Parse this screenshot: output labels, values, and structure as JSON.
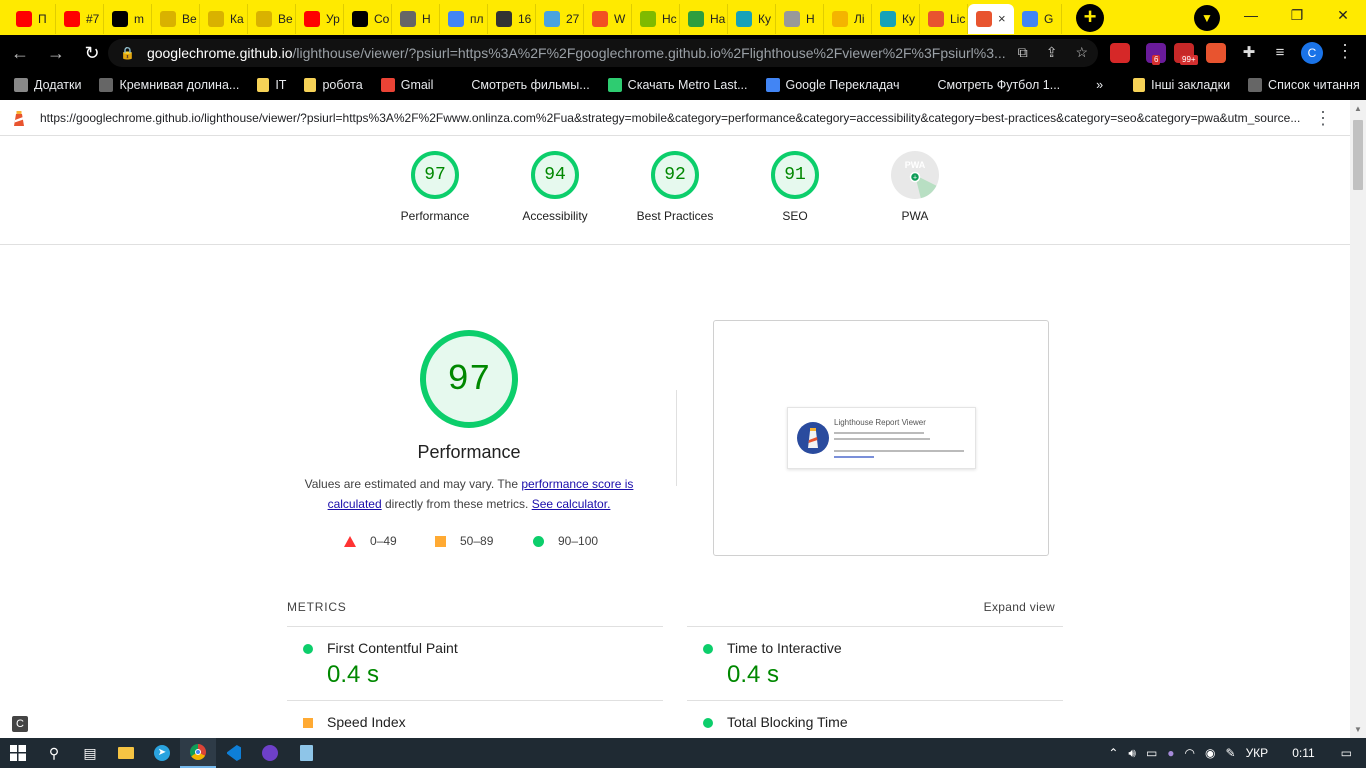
{
  "browser": {
    "tabs": [
      {
        "label": "П",
        "icon": "youtube-icon",
        "color": "#ff0000"
      },
      {
        "label": "#7",
        "icon": "youtube-icon",
        "color": "#ff0000"
      },
      {
        "label": "m",
        "icon": "github-icon",
        "color": "#000000"
      },
      {
        "label": "Ве",
        "icon": "wave-icon",
        "color": "#d9b200"
      },
      {
        "label": "Ка",
        "icon": "wave-icon",
        "color": "#d9b200"
      },
      {
        "label": "Ве",
        "icon": "wave-icon",
        "color": "#d9b200"
      },
      {
        "label": "Ур",
        "icon": "youtube-icon",
        "color": "#ff0000"
      },
      {
        "label": "Co",
        "icon": "z-icon",
        "color": "#000000"
      },
      {
        "label": "Н",
        "icon": "globe-icon",
        "color": "#666666"
      },
      {
        "label": "пл",
        "icon": "google-icon",
        "color": "#4285f4"
      },
      {
        "label": "16",
        "icon": "shield-icon",
        "color": "#333333"
      },
      {
        "label": "27",
        "icon": "cloud-icon",
        "color": "#4aa3df"
      },
      {
        "label": "W",
        "icon": "windows-icon",
        "color": "#f25022"
      },
      {
        "label": "Нс",
        "icon": "windows-icon",
        "color": "#7fba00"
      },
      {
        "label": "На",
        "icon": "leaf-icon",
        "color": "#2e9e3e"
      },
      {
        "label": "Ку",
        "icon": "on-icon",
        "color": "#17a2b8"
      },
      {
        "label": "Н",
        "icon": "gear-icon",
        "color": "#999999"
      },
      {
        "label": "Лі",
        "icon": "pie-icon",
        "color": "#f4b400"
      },
      {
        "label": "Ку",
        "icon": "on-icon",
        "color": "#17a2b8"
      },
      {
        "label": "Lic",
        "icon": "lighthouse-icon",
        "color": "#e8542f"
      },
      {
        "label": "G",
        "icon": "translate-icon",
        "color": "#4285f4"
      }
    ],
    "active_tab": {
      "label": "×",
      "icon": "lighthouse-icon"
    },
    "new_tab": "+",
    "url_host": "googlechrome.github.io",
    "url_path": "/lighthouse/viewer/?psiurl=https%3A%2F%2Fgooglechrome.github.io%2Flighthouse%2Fviewer%2F%3Fpsiurl%3...",
    "extensions": [
      {
        "icon": "s-ext-icon",
        "color": "#d62828",
        "badge": ""
      },
      {
        "icon": "purple-ext-icon",
        "color": "#6a1b9a",
        "badge": "6"
      },
      {
        "icon": "g-ext-icon",
        "color": "#c62828",
        "badge": "99+"
      },
      {
        "icon": "lighthouse-ext-icon",
        "color": "#e8542f",
        "badge": ""
      }
    ],
    "avatar": "C",
    "bookmarks": [
      {
        "label": "Додатки",
        "icon": "apps-icon"
      },
      {
        "label": "Кремнивая долина...",
        "icon": "globe-icon"
      },
      {
        "label": "IT",
        "icon": "folder-icon"
      },
      {
        "label": "робота",
        "icon": "folder-icon"
      },
      {
        "label": "Gmail",
        "icon": "gmail-icon"
      },
      {
        "label": "Смотреть фильмы...",
        "icon": "z-icon"
      },
      {
        "label": "Скачать Metro Last...",
        "icon": "t-icon"
      },
      {
        "label": "Google Перекладач",
        "icon": "translate-icon"
      },
      {
        "label": "Смотреть Футбол 1...",
        "icon": "ball-icon"
      }
    ],
    "bookmarks_right": [
      {
        "label": "Інші закладки",
        "icon": "folder-icon"
      },
      {
        "label": "Список читання",
        "icon": "reading-list-icon"
      }
    ]
  },
  "lighthouse": {
    "report_url": "https://googlechrome.github.io/lighthouse/viewer/?psiurl=https%3A%2F%2Fwww.onlinza.com%2Fua&strategy=mobile&category=performance&category=accessibility&category=best-practices&category=seo&category=pwa&utm_source...",
    "scores": [
      {
        "label": "Performance",
        "value": "97"
      },
      {
        "label": "Accessibility",
        "value": "94"
      },
      {
        "label": "Best Practices",
        "value": "92"
      },
      {
        "label": "SEO",
        "value": "91"
      }
    ],
    "pwa": {
      "label": "PWA",
      "badge": "PWA"
    },
    "performance": {
      "score": "97",
      "title": "Performance",
      "desc_1": "Values are estimated and may vary. The ",
      "desc_link_1": "performance score is calculated",
      "desc_2": " directly from these metrics. ",
      "desc_link_2": "See calculator.",
      "legend": [
        {
          "range": "0–49",
          "kind": "fail",
          "color": "#ff3333"
        },
        {
          "range": "50–89",
          "kind": "average",
          "color": "#ffaa33"
        },
        {
          "range": "90–100",
          "kind": "pass",
          "color": "#0cce6b"
        }
      ]
    },
    "screenshot": {
      "title": "Lighthouse Report Viewer"
    },
    "metrics": {
      "heading": "METRICS",
      "expand": "Expand view",
      "items": [
        {
          "name": "First Contentful Paint",
          "value": "0.4 s",
          "status": "pass"
        },
        {
          "name": "Time to Interactive",
          "value": "0.4 s",
          "status": "pass"
        },
        {
          "name": "Speed Index",
          "value": "",
          "status": "average"
        },
        {
          "name": "Total Blocking Time",
          "value": "",
          "status": "pass"
        }
      ]
    }
  },
  "taskbar": {
    "apps": [
      {
        "icon": "windows-start-icon"
      },
      {
        "icon": "search-icon"
      },
      {
        "icon": "task-view-icon"
      },
      {
        "icon": "file-explorer-icon"
      },
      {
        "icon": "telegram-icon"
      },
      {
        "icon": "chrome-icon",
        "active": true
      },
      {
        "icon": "vscode-icon"
      },
      {
        "icon": "github-desktop-icon"
      },
      {
        "icon": "notepad-icon"
      }
    ],
    "language": "УКР",
    "time": "0:11"
  }
}
